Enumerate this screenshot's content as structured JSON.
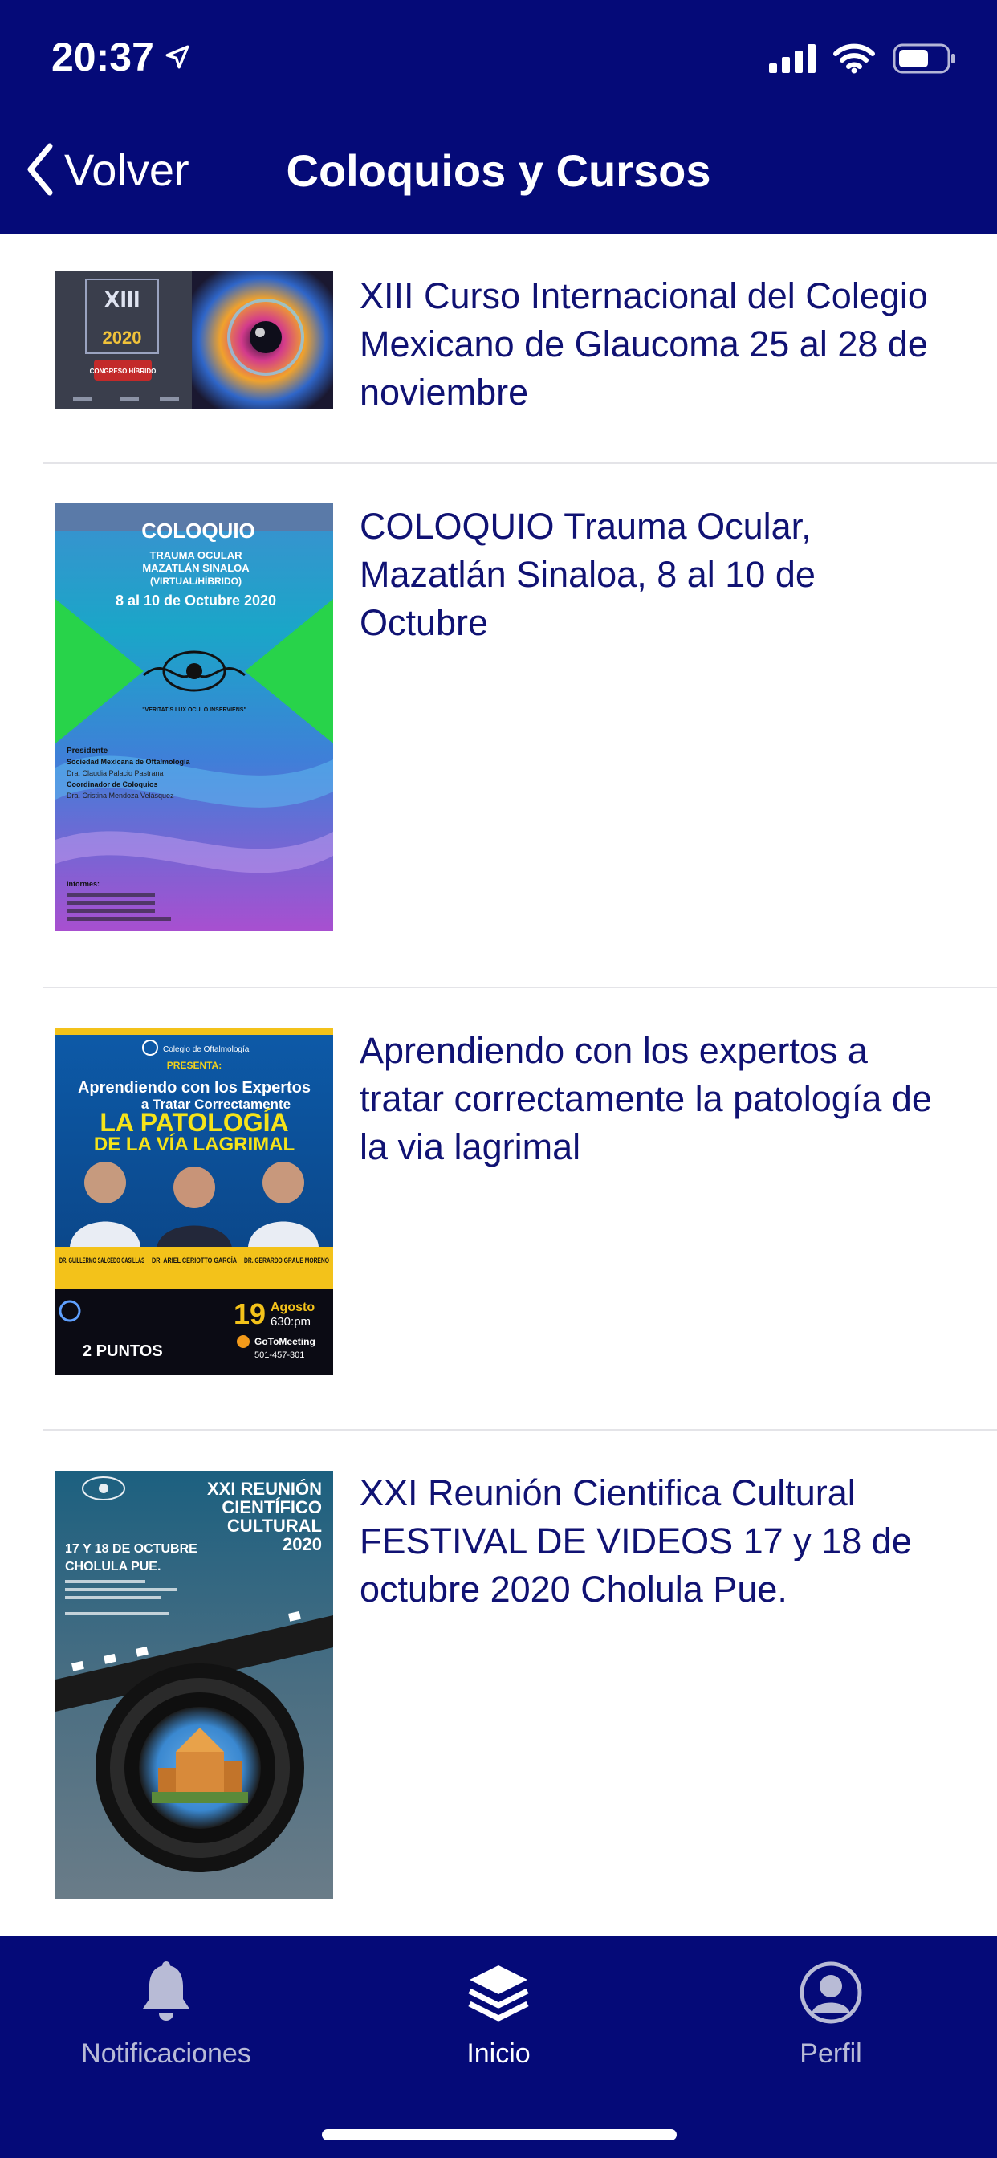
{
  "status": {
    "time": "20:37"
  },
  "nav": {
    "back_label": "Volver",
    "title": "Coloquios y Cursos"
  },
  "items": [
    {
      "text": "XIII Curso Internacional del Colegio Mexicano de Glaucoma 25 al 28 de noviembre",
      "poster": {
        "big": "XIII",
        "year": "2020",
        "badge": "CONGRESO HÍBRIDO"
      }
    },
    {
      "text": "COLOQUIO Trauma Ocular, Mazatlán Sinaloa, 8 al 10 de Octubre",
      "poster": {
        "title": "COLOQUIO",
        "line1": "TRAUMA OCULAR",
        "line2": "MAZATLÁN SINALOA",
        "line3": "(VIRTUAL/HÍBRIDO)",
        "date": "8 al 10 de Octubre 2020",
        "motto": "\"VERITATIS LUX OCULO INSERVIENS\"",
        "p1": "Presidente",
        "p2": "Sociedad Mexicana de Oftalmología",
        "p3": "Dra. Claudia Palacio Pastrana",
        "p4": "Coordinador de Coloquios",
        "p5": "Dra. Cristina Mendoza Velásquez",
        "informes": "Informes:"
      }
    },
    {
      "text": "Aprendiendo con los expertos a tratar correctamente la patología de la via lagrimal",
      "poster": {
        "org": "Colegio de Oftalmología",
        "presenta": "PRESENTA:",
        "l1": "Aprendiendo con los Expertos",
        "l2": "a Tratar Correctamente",
        "l3": "LA PATOLOGÍA",
        "l4": "DE LA VÍA LAGRIMAL",
        "d1": "DR. GUILLERMO SALCEDO CASILLAS",
        "d2": "DR. ARIEL CERIOTTO GARCÍA",
        "d3": "DR. GERARDO GRAUE MORENO",
        "day": "19",
        "month": "Agosto",
        "hour": "630:pm",
        "puntos": "2 PUNTOS",
        "meeting": "GoToMeeting",
        "meeting_id": "501-457-301"
      }
    },
    {
      "text": "XXI Reunión Cientifica Cultural FESTIVAL DE VIDEOS 17 y 18 de octubre 2020 Cholula Pue.",
      "poster": {
        "t1": "XXI REUNIÓN",
        "t2": "CIENTÍFICO",
        "t3": "CULTURAL",
        "t4": "2020",
        "date": "17 Y 18 DE OCTUBRE",
        "place": "CHOLULA PUE."
      }
    }
  ],
  "tabs": [
    {
      "label": "Notificaciones",
      "icon": "bell-icon",
      "active": false
    },
    {
      "label": "Inicio",
      "icon": "layers-icon",
      "active": true
    },
    {
      "label": "Perfil",
      "icon": "profile-icon",
      "active": false
    }
  ],
  "colors": {
    "primary": "#050a78",
    "text": "#101273",
    "inactive_tab": "#b8bbd6"
  }
}
